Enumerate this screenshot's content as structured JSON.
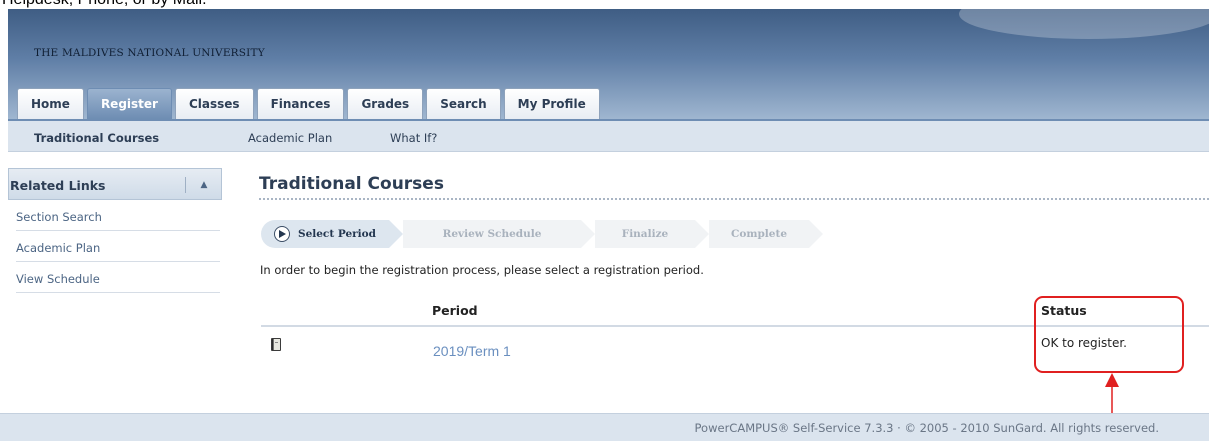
{
  "document_top_text": "Helpdesk, Phone, or by Mail.",
  "header": {
    "university_name": "THE MALDIVES NATIONAL UNIVERSITY"
  },
  "tabs": [
    {
      "label": "Home",
      "active": false
    },
    {
      "label": "Register",
      "active": true
    },
    {
      "label": "Classes",
      "active": false
    },
    {
      "label": "Finances",
      "active": false
    },
    {
      "label": "Grades",
      "active": false
    },
    {
      "label": "Search",
      "active": false
    },
    {
      "label": "My Profile",
      "active": false
    }
  ],
  "subnav": {
    "items": [
      "Traditional Courses",
      "Academic Plan",
      "What If?"
    ],
    "current": "Traditional Courses"
  },
  "sidebar": {
    "title": "Related Links",
    "collapse_icon": "triangle-up-icon",
    "links": [
      "Section Search",
      "Academic Plan",
      "View Schedule"
    ]
  },
  "main": {
    "title": "Traditional Courses",
    "steps": [
      "Select Period",
      "Review Schedule",
      "Finalize",
      "Complete"
    ],
    "active_step": "Select Period",
    "instruction": "In order to begin the registration process, please select a registration period.",
    "table": {
      "headers": {
        "period": "Period",
        "status": "Status"
      },
      "rows": [
        {
          "icon": "book-icon",
          "period": "2019/Term 1",
          "status": "OK to register."
        }
      ]
    }
  },
  "footer": {
    "text": "PowerCAMPUS® Self-Service 7.3.3 · © 2005 - 2010 SunGard. All rights reserved."
  },
  "colors": {
    "header_dark": "#3f5d84",
    "tab_active": "#6e8db3",
    "link": "#6a8fbf",
    "annotation": "#e02020"
  }
}
